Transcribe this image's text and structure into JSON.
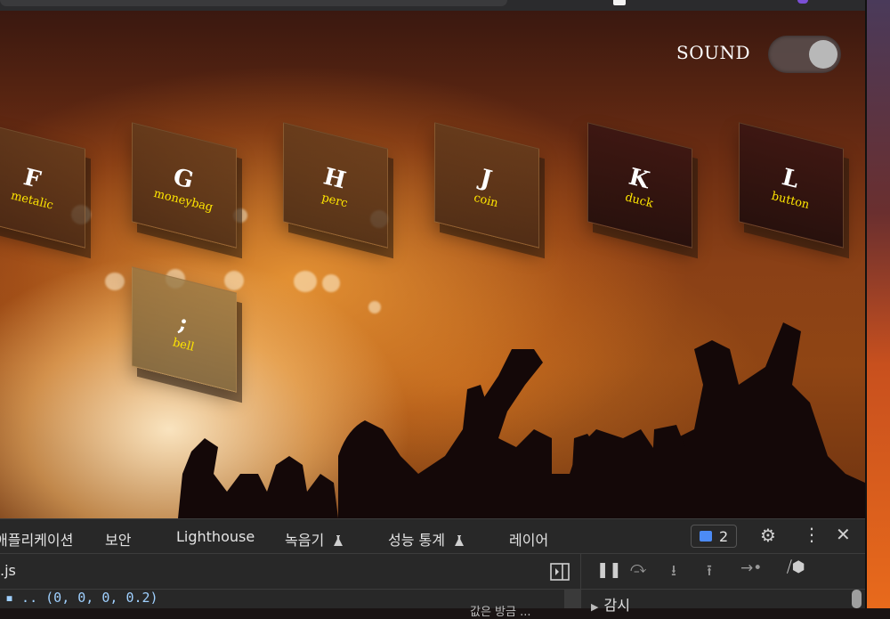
{
  "game": {
    "sound_label": "SOUND",
    "sound_on": true,
    "keys_row1": [
      {
        "letter": "F",
        "sound": "metalic",
        "style": "normal"
      },
      {
        "letter": "G",
        "sound": "moneybag",
        "style": "normal"
      },
      {
        "letter": "H",
        "sound": "perc",
        "style": "normal"
      },
      {
        "letter": "J",
        "sound": "coin",
        "style": "normal"
      },
      {
        "letter": "K",
        "sound": "duck",
        "style": "dark"
      },
      {
        "letter": "L",
        "sound": "button",
        "style": "dark"
      }
    ],
    "key_row2": {
      "letter": ";",
      "sound": "bell",
      "style": "light"
    }
  },
  "devtools": {
    "tabs": [
      {
        "label": "애플리케이션",
        "flask": false
      },
      {
        "label": "보안",
        "flask": false
      },
      {
        "label": "Lighthouse",
        "flask": false
      },
      {
        "label": "녹음기",
        "flask": true
      },
      {
        "label": "성능 통계",
        "flask": true
      },
      {
        "label": "레이어",
        "flask": false
      }
    ],
    "issues_count": "2",
    "file_name": ".js",
    "watch_label": "감시",
    "code_snippet": "▪ .. (0, 0, 0, 0.2)",
    "code_hint": "값은 방금 ..."
  },
  "colors": {
    "key_label": "#ffe600",
    "issues_badge": "#4c8bf5",
    "devtools_bg": "#282828"
  },
  "icons": [
    "gear-icon",
    "more-vert-icon",
    "close-icon",
    "pause-icon",
    "step-over-icon",
    "step-into-icon",
    "step-out-icon",
    "step-icon",
    "deactivate-breakpoints-icon",
    "dock-side-icon",
    "chat-icon",
    "flask-icon"
  ]
}
